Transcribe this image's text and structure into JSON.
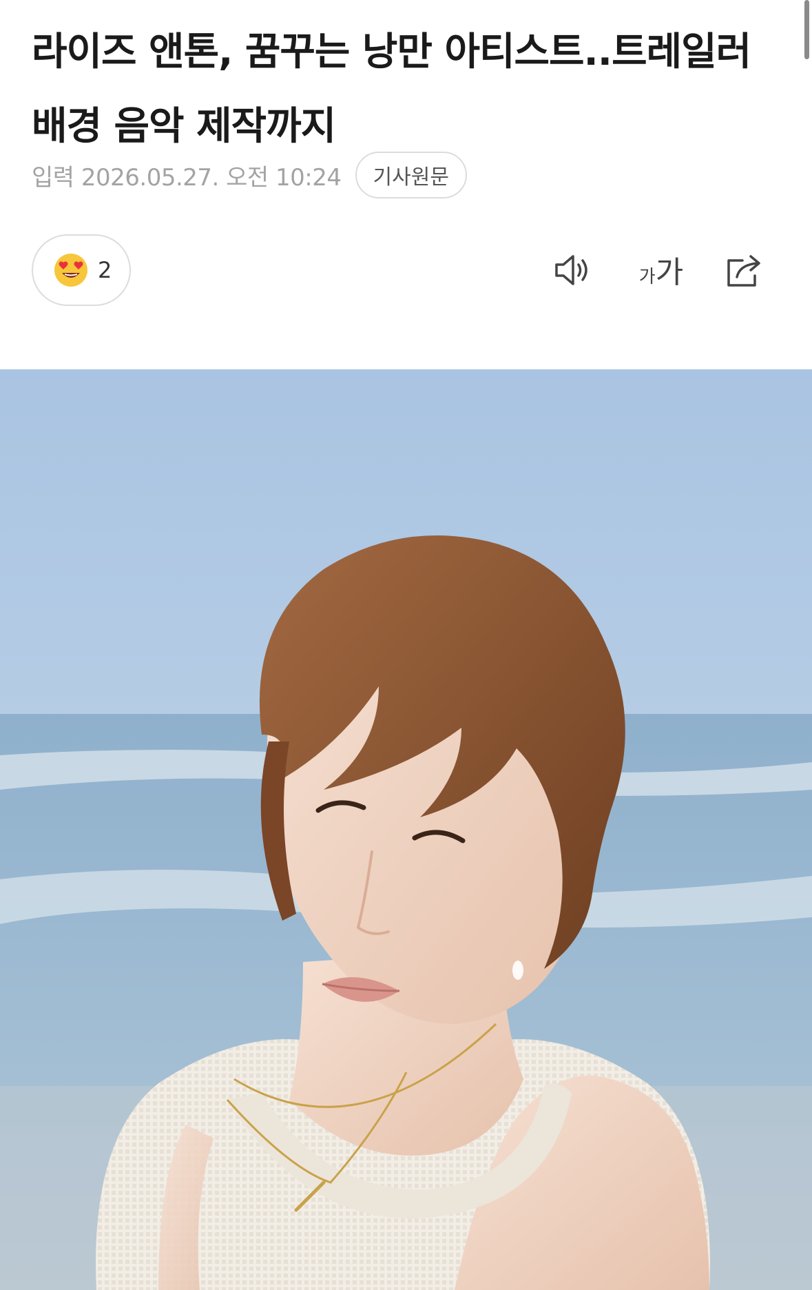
{
  "article": {
    "headline": "라이즈 앤톤, 꿈꾸는 낭만 아티스트..트레일러 배경 음악 제작까지",
    "published": "입력 2026.05.27. 오전 10:24",
    "source_button": "기사원문"
  },
  "reactions": {
    "emoji": "heart-eyes-emoji",
    "count": "2"
  },
  "toolbar": {
    "font_small": "가",
    "font_large": "가",
    "icons": [
      "speaker-icon",
      "font-size-icon",
      "share-icon"
    ]
  },
  "photo": {
    "subject": "portrait-photo",
    "colors": {
      "sky": "#b9cfe4",
      "sea": "#86a6c2",
      "hair": "#8a5230",
      "skin": "#f2d7c6",
      "top": "#f1ece4"
    }
  }
}
